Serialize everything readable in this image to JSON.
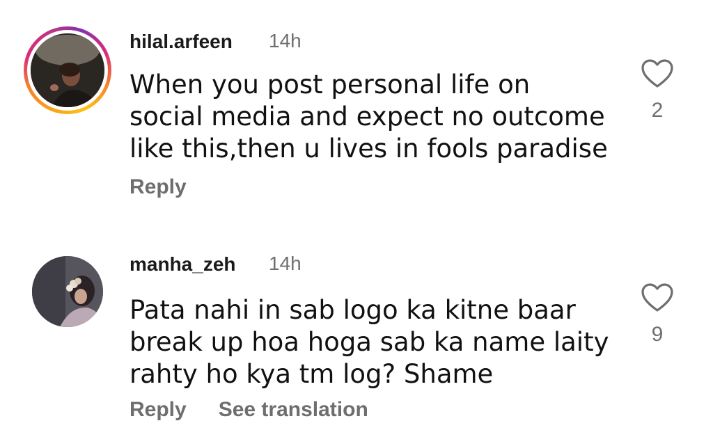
{
  "comments": [
    {
      "username": "hilal.arfeen",
      "time": "14h",
      "text_lines": [
        "When you post personal life on",
        "social media and expect no outcome",
        "like this,then u lives in fools paradise"
      ],
      "actions": [
        "Reply"
      ],
      "likes": "2",
      "has_story_ring": true,
      "icon": "heart-outline-icon"
    },
    {
      "username": "manha_zeh",
      "time": "14h",
      "text_lines": [
        "Pata nahi in sab logo ka kitne baar",
        "break up hoa hoga sab ka name laity",
        "rahty ho kya tm log? Shame"
      ],
      "actions": [
        "Reply",
        "See translation"
      ],
      "likes": "9",
      "has_story_ring": false,
      "icon": "heart-outline-icon"
    }
  ],
  "colors": {
    "text": "#111111",
    "secondary": "#6e6e6e",
    "ring_start": "#f9a11a",
    "ring_end": "#c13584"
  }
}
